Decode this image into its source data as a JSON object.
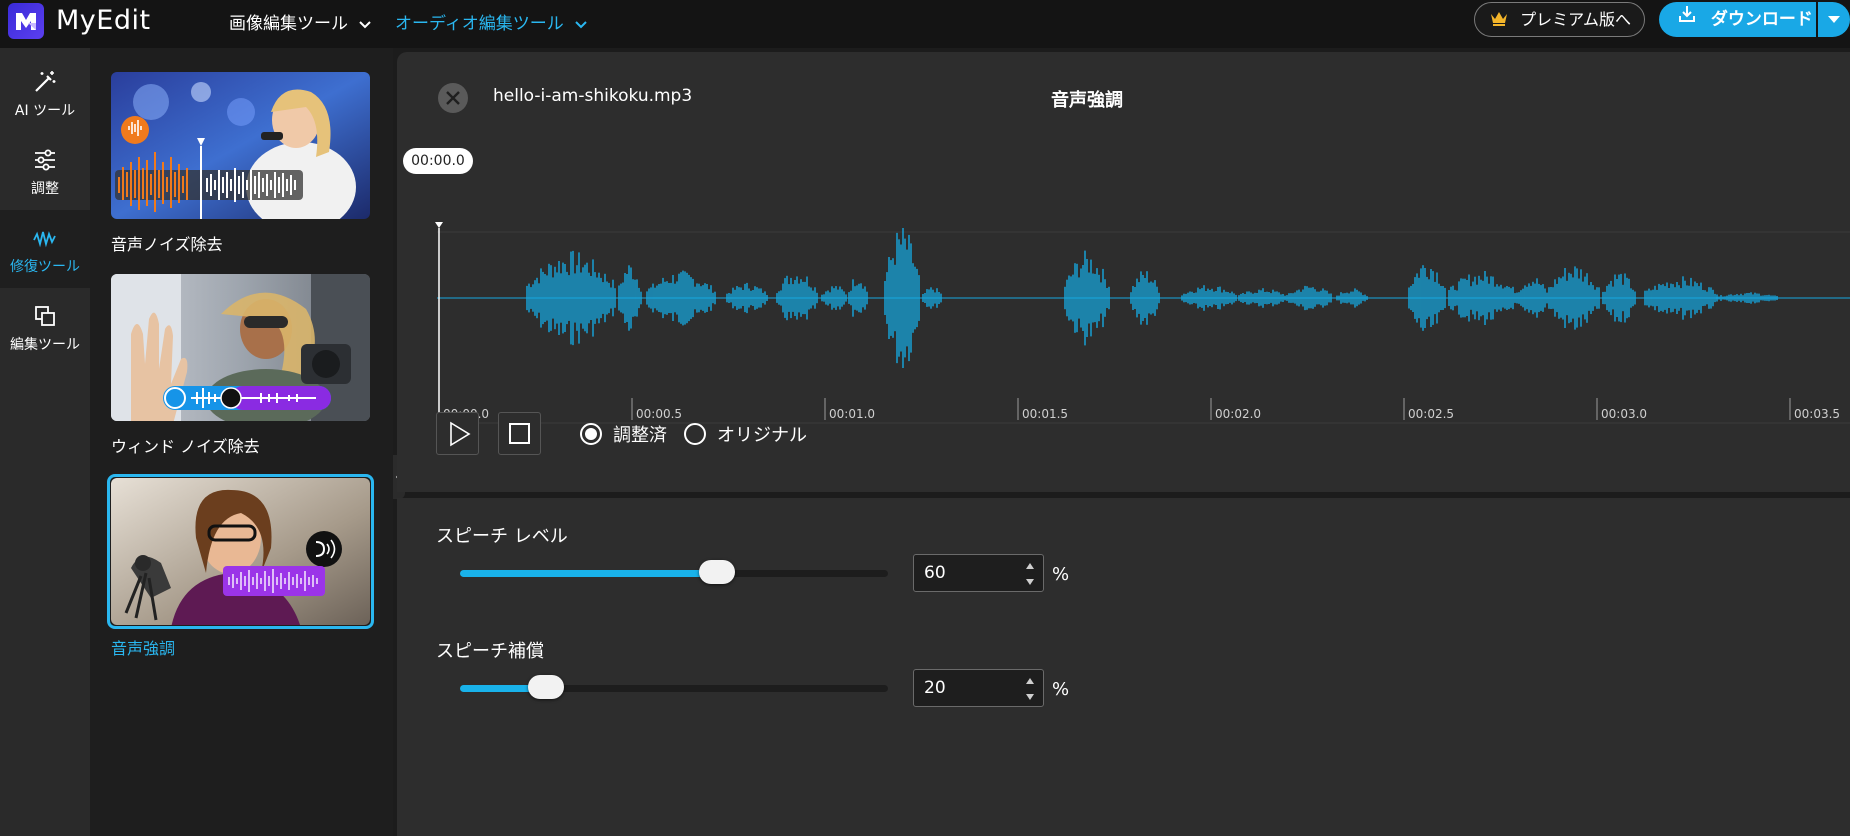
{
  "app": {
    "name": "MyEdit",
    "accent_color": "#2ab7f0",
    "waveform_color": "#16a8e0"
  },
  "topnav": {
    "items": [
      {
        "label": "画像編集ツール",
        "active": false
      },
      {
        "label": "オーディオ編集ツール",
        "active": true
      }
    ],
    "premium_label": "プレミアム版へ",
    "download_label": "ダウンロード"
  },
  "sidebar": {
    "items": [
      {
        "label": "AI ツール",
        "icon": "magic-wand-icon",
        "active": false
      },
      {
        "label": "調整",
        "icon": "sliders-icon",
        "active": false
      },
      {
        "label": "修復ツール",
        "icon": "waveform-repair-icon",
        "active": true
      },
      {
        "label": "編集ツール",
        "icon": "copy-layers-icon",
        "active": false
      }
    ]
  },
  "tools": {
    "cards": [
      {
        "label": "音声ノイズ除去",
        "active": false
      },
      {
        "label": "ウィンド ノイズ除去",
        "active": false
      },
      {
        "label": "音声強調",
        "active": true
      }
    ]
  },
  "player": {
    "file_name": "hello-i-am-shikoku.mp3",
    "title": "音声強調",
    "current_time": "00:00.0",
    "timeline_ticks": [
      "00:00.0",
      "00:00.5",
      "00:01.0",
      "00:01.5",
      "00:02.0",
      "00:02.5",
      "00:03.0",
      "00:03.5"
    ],
    "playback_mode_options": [
      {
        "label": "調整済",
        "selected": true
      },
      {
        "label": "オリジナル",
        "selected": false
      }
    ]
  },
  "settings": {
    "speech_level": {
      "label": "スピーチ レベル",
      "value": "60",
      "unit": "%",
      "fraction": 0.6
    },
    "speech_compensation": {
      "label": "スピーチ補償",
      "value": "20",
      "unit": "%",
      "fraction": 0.2
    }
  }
}
